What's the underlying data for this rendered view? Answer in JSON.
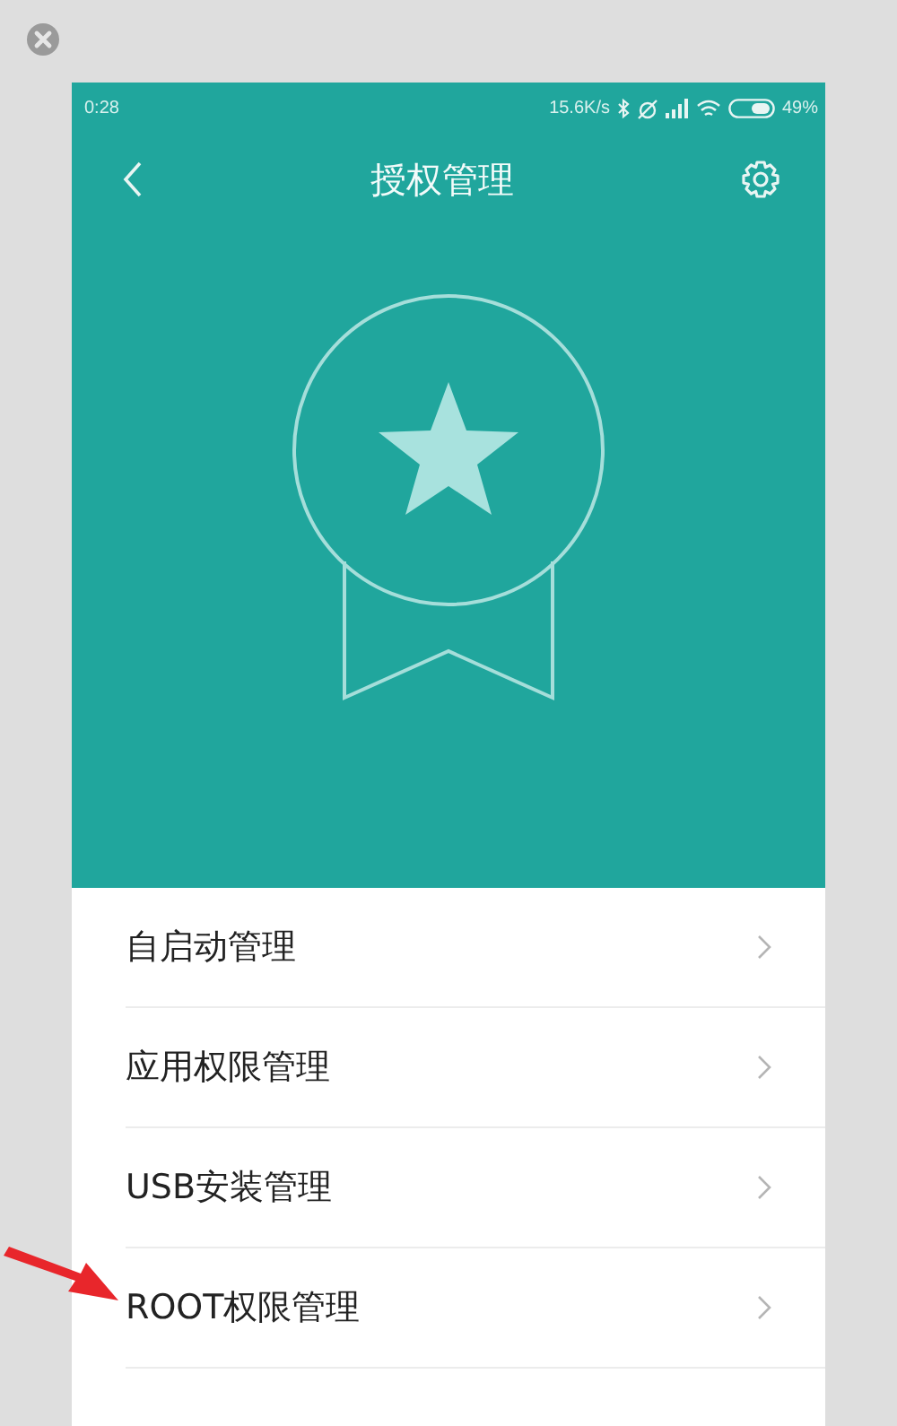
{
  "status_bar": {
    "time": "0:28",
    "speed": "15.6K/s",
    "battery": "49%"
  },
  "header": {
    "title": "授权管理"
  },
  "menu": [
    {
      "label": "自启动管理",
      "marked": false
    },
    {
      "label": "应用权限管理",
      "marked": false
    },
    {
      "label": "USB安装管理",
      "marked": false
    },
    {
      "label": "ROOT权限管理",
      "marked": true
    }
  ]
}
